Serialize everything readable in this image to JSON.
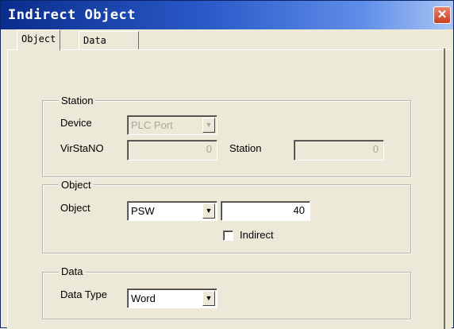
{
  "window": {
    "title": "Indirect Object",
    "close_glyph": "✕"
  },
  "tabs": [
    {
      "label": "Object",
      "active": true
    },
    {
      "label": "Data",
      "active": false
    }
  ],
  "station_group": {
    "legend": "Station",
    "device_label": "Device",
    "device_value": "PLC Port",
    "virstano_label": "VirStaNO",
    "virstano_value": "0",
    "station_label": "Station",
    "station_value": "0"
  },
  "object_group": {
    "legend": "Object",
    "object_label": "Object",
    "object_select_value": "PSW",
    "object_number_value": "40",
    "indirect_label": "Indirect",
    "indirect_checked": false
  },
  "data_group": {
    "legend": "Data",
    "data_type_label": "Data Type",
    "data_type_value": "Word"
  },
  "icons": {
    "dropdown_arrow": "▼",
    "close": "close-icon",
    "dropdown": "chevron-down-icon"
  },
  "colors": {
    "titlebar_start": "#0a2d8c",
    "titlebar_end": "#a8c4f3",
    "close_button": "#c8401f",
    "dialog_face": "#ece9d8"
  }
}
